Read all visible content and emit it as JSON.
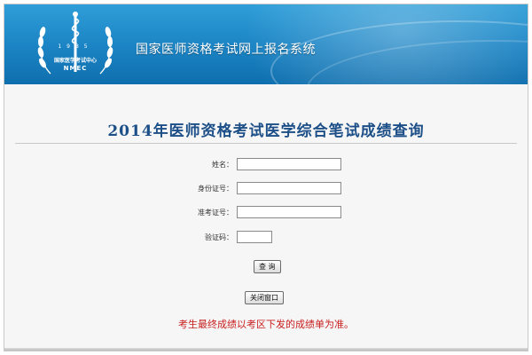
{
  "header": {
    "emblem": {
      "year": "1985",
      "org_cn": "国家医学考试中心",
      "org_en": "NMEC"
    },
    "system_title": "国家医师资格考试网上报名系统"
  },
  "main": {
    "title": "2014年医师资格考试医学综合笔试成绩查询",
    "form": {
      "name_label": "姓名：",
      "id_label": "身份证号：",
      "ticket_label": "准考证号：",
      "captcha_label": "验证码：",
      "name_value": "",
      "id_value": "",
      "ticket_value": "",
      "captcha_value": ""
    },
    "query_button": "查 询",
    "close_button": "关闭窗口",
    "notice": "考生最终成绩以考区下发的成绩单为准。"
  },
  "colors": {
    "banner": "#1d86c6",
    "title": "#1c4f87",
    "notice": "#c81e1e"
  }
}
